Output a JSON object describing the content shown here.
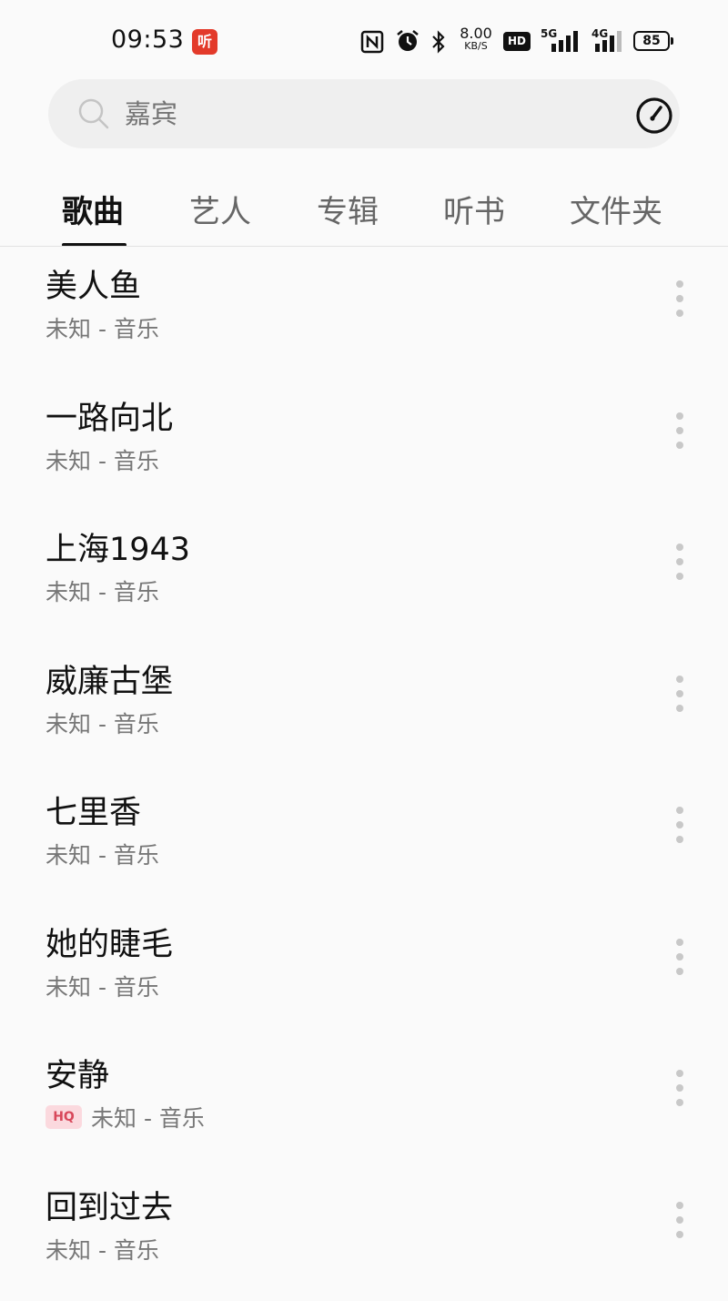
{
  "status": {
    "time": "09:53",
    "notif_label": "听",
    "net_speed": "8.00",
    "net_speed_unit": "KB/S",
    "hd_label": "HD",
    "net_5g": "5G",
    "net_4g": "4G",
    "battery": "85"
  },
  "search": {
    "placeholder": "嘉宾"
  },
  "tabs": [
    {
      "label": "歌曲",
      "active": true
    },
    {
      "label": "艺人"
    },
    {
      "label": "专辑"
    },
    {
      "label": "听书"
    },
    {
      "label": "文件夹"
    }
  ],
  "songs": [
    {
      "title": "美人鱼",
      "subtitle": "未知 - 音乐"
    },
    {
      "title": "一路向北",
      "subtitle": "未知 - 音乐"
    },
    {
      "title": "上海1943",
      "subtitle": "未知 - 音乐"
    },
    {
      "title": "威廉古堡",
      "subtitle": "未知 - 音乐"
    },
    {
      "title": "七里香",
      "subtitle": "未知 - 音乐"
    },
    {
      "title": "她的睫毛",
      "subtitle": "未知 - 音乐"
    },
    {
      "title": "安静",
      "subtitle": "未知 - 音乐",
      "badge": "HQ"
    },
    {
      "title": "回到过去",
      "subtitle": "未知 - 音乐"
    }
  ],
  "colors": {
    "background": "#fafafa",
    "hq_badge_bg": "#fbd9de",
    "hq_badge_text": "#d8475a",
    "notif_red": "#e33a2a"
  }
}
